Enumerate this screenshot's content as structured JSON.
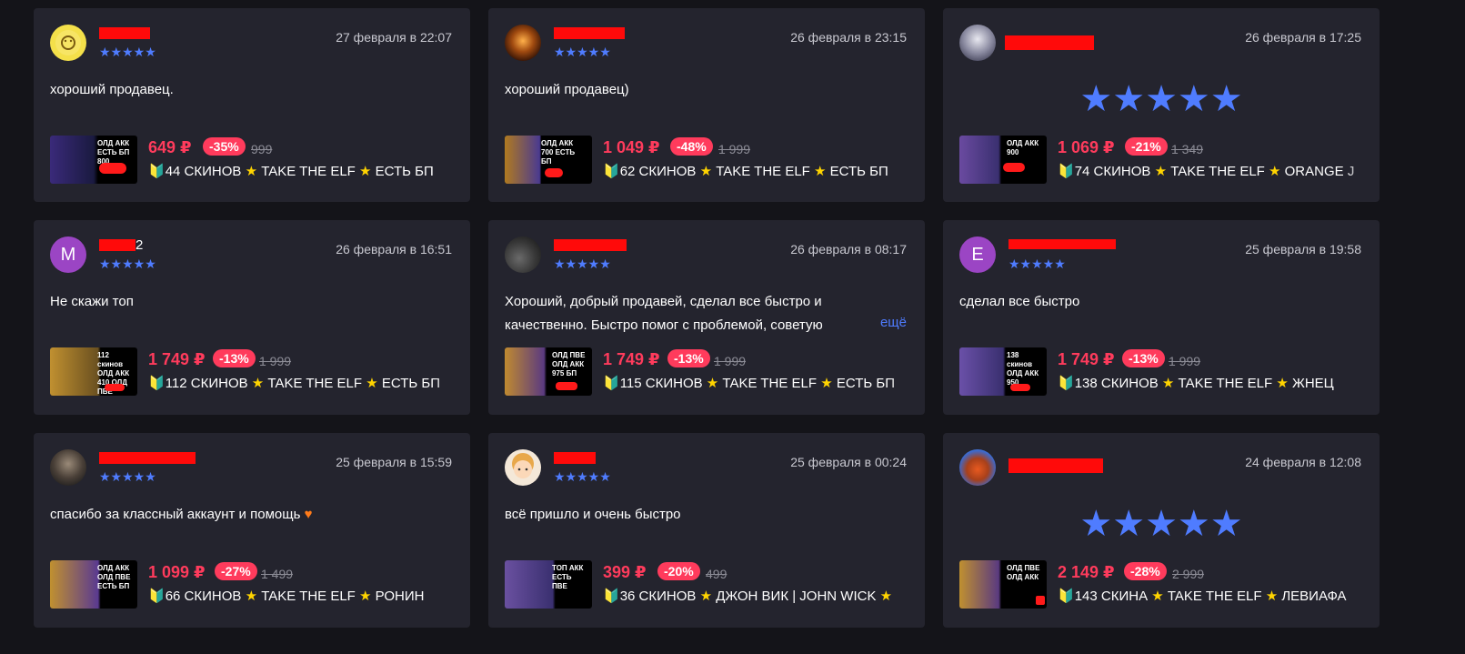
{
  "reviews": [
    {
      "date": "27 февраля в 22:07",
      "text": "хороший продавец.",
      "stars": "★★★★★",
      "price": "649 ₽",
      "discount": "-35%",
      "old_price": "999",
      "thumb_text": "ОЛД АКК ЕСТЬ БП 800",
      "title_count": "44 СКИНОВ",
      "title_rest": "TAKE THE ELF",
      "title_tail": "ЕСТЬ БП"
    },
    {
      "date": "26 февраля в 23:15",
      "text": "хороший продавец)",
      "stars": "★★★★★",
      "price": "1 049 ₽",
      "discount": "-48%",
      "old_price": "1 999",
      "thumb_text": "ОЛД АКК 700 ЕСТЬ БП",
      "title_count": "62 СКИНОВ",
      "title_rest": "TAKE THE ELF",
      "title_tail": "ЕСТЬ БП"
    },
    {
      "date": "26 февраля в 17:25",
      "text": "",
      "stars": "★★★★★",
      "price": "1 069 ₽",
      "discount": "-21%",
      "old_price": "1 349",
      "thumb_text": "ОЛД АКК 900",
      "title_count": "74 СКИНОВ",
      "title_rest": "TAKE THE ELF",
      "title_tail": "ORANGE J"
    },
    {
      "avatar_letter": "M",
      "name_suffix": "2",
      "date": "26 февраля в 16:51",
      "text": "Не скажи топ",
      "stars": "★★★★★",
      "price": "1 749 ₽",
      "discount": "-13%",
      "old_price": "1 999",
      "thumb_text": "112 скинов ОЛД АКК 410 ОЛД ПВЕ",
      "title_count": "112 СКИНОВ",
      "title_rest": "TAKE THE ELF",
      "title_tail": "ЕСТЬ БП"
    },
    {
      "date": "26 февраля в 08:17",
      "text": "Хороший, добрый продавей, сделал все быстро и качественно. Быстро помог с проблемой, советую",
      "more": "ещё",
      "stars": "★★★★★",
      "price": "1 749 ₽",
      "discount": "-13%",
      "old_price": "1 999",
      "thumb_text": "ОЛД ПВЕ ОЛД АКК 975 БП",
      "title_count": "115 СКИНОВ",
      "title_rest": "TAKE THE ELF",
      "title_tail": "ЕСТЬ БП"
    },
    {
      "avatar_letter": "E",
      "date": "25 февраля в 19:58",
      "text": "сделал все быстро",
      "stars": "★★★★★",
      "price": "1 749 ₽",
      "discount": "-13%",
      "old_price": "1 999",
      "thumb_text": "138 скинов ОЛД АКК 950",
      "title_count": "138 СКИНОВ",
      "title_rest": "TAKE THE ELF",
      "title_tail": "ЖНЕЦ"
    },
    {
      "date": "25 февраля в 15:59",
      "text": "спасибо за классный аккаунт и помощь",
      "heart": "♥",
      "stars": "★★★★★",
      "price": "1 099 ₽",
      "discount": "-27%",
      "old_price": "1 499",
      "thumb_text": "ОЛД АКК ОЛД ПВЕ ЕСТЬ БП",
      "title_count": "66 СКИНОВ",
      "title_rest": "TAKE THE ELF",
      "title_tail": "РОНИН"
    },
    {
      "date": "25 февраля в 00:24",
      "text": "всё пришло и очень быстро",
      "stars": "★★★★★",
      "price": "399 ₽",
      "discount": "-20%",
      "old_price": "499",
      "thumb_text": "ТОП АКК ЕСТЬ ПВЕ",
      "title_count": "36 СКИНОВ",
      "title_rest": "ДЖОН ВИК | JOHN WICK",
      "title_tail": ""
    },
    {
      "date": "24 февраля в 12:08",
      "text": "",
      "stars": "★★★★★",
      "price": "2 149 ₽",
      "discount": "-28%",
      "old_price": "2 999",
      "thumb_text": "ОЛД ПВЕ ОЛД АКК",
      "title_count": "143 СКИНА",
      "title_rest": "TAKE THE ELF",
      "title_tail": "ЛЕВИАФА"
    }
  ],
  "icons": {
    "leaf": "🔰",
    "star": "★"
  },
  "colors": {
    "accent_red": "#ff3b5c",
    "star_blue": "#4f7cff",
    "card_bg": "#24242e",
    "page_bg": "#141419"
  }
}
